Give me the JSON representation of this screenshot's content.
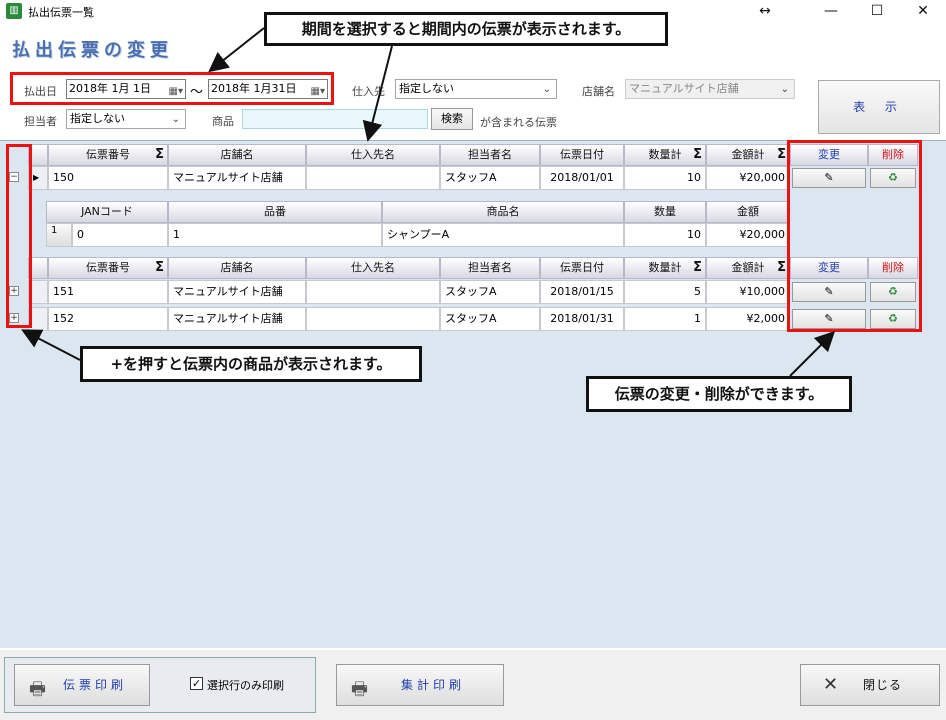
{
  "window": {
    "title": "払出伝票一覧",
    "resize_icon": "↔",
    "min_icon": "—",
    "max_icon": "☐",
    "close_icon": "✕"
  },
  "heading": "払出伝票の変更",
  "filters": {
    "date_label": "払出日",
    "date_from": "2018年  1月  1日",
    "date_sep": "～",
    "date_to": "2018年  1月31日",
    "supplier_label": "仕入先",
    "supplier_value": "指定しない",
    "store_label": "店舗名",
    "store_value": "マニュアルサイト店舗",
    "staff_label": "担当者",
    "staff_value": "指定しない",
    "product_label": "商品",
    "product_value": "",
    "search_label": "検索",
    "product_suffix": "が含まれる伝票",
    "show_label": "表 示"
  },
  "grid": {
    "headers": [
      "伝票番号",
      "店舗名",
      "仕入先名",
      "担当者名",
      "伝票日付",
      "数量計",
      "金額計",
      "変更",
      "削除"
    ],
    "sub_headers": [
      "JANコード",
      "品番",
      "商品名",
      "数量",
      "金額"
    ],
    "rows": [
      {
        "no": "150",
        "store": "マニュアルサイト店舗",
        "supplier": "",
        "staff": "スタッフA",
        "date": "2018/01/01",
        "qty": "10",
        "amount": "¥20,000"
      },
      {
        "no": "151",
        "store": "マニュアルサイト店舗",
        "supplier": "",
        "staff": "スタッフA",
        "date": "2018/01/15",
        "qty": "5",
        "amount": "¥10,000"
      },
      {
        "no": "152",
        "store": "マニュアルサイト店舗",
        "supplier": "",
        "staff": "スタッフA",
        "date": "2018/01/31",
        "qty": "1",
        "amount": "¥2,000"
      }
    ],
    "detail_rows": [
      {
        "idx": "1",
        "jan": "0",
        "part": "1",
        "name": "シャンプーA",
        "qty": "10",
        "amount": "¥20,000"
      }
    ]
  },
  "callouts": {
    "top": "期間を選択すると期間内の伝票が表示されます。",
    "left": "+を押すと伝票内の商品が表示されます。",
    "right": "伝票の変更・削除ができます。"
  },
  "footer": {
    "print_label": "伝票印刷",
    "selected_only_label": "選択行のみ印刷",
    "selected_only_checked": true,
    "summary_print_label": "集計印刷",
    "close_label": "閉じる"
  },
  "colors": {
    "highlight": "#ee1111",
    "heading": "#4a6fb0",
    "edit_header": "#2040b0",
    "delete_header": "#cc1111"
  }
}
